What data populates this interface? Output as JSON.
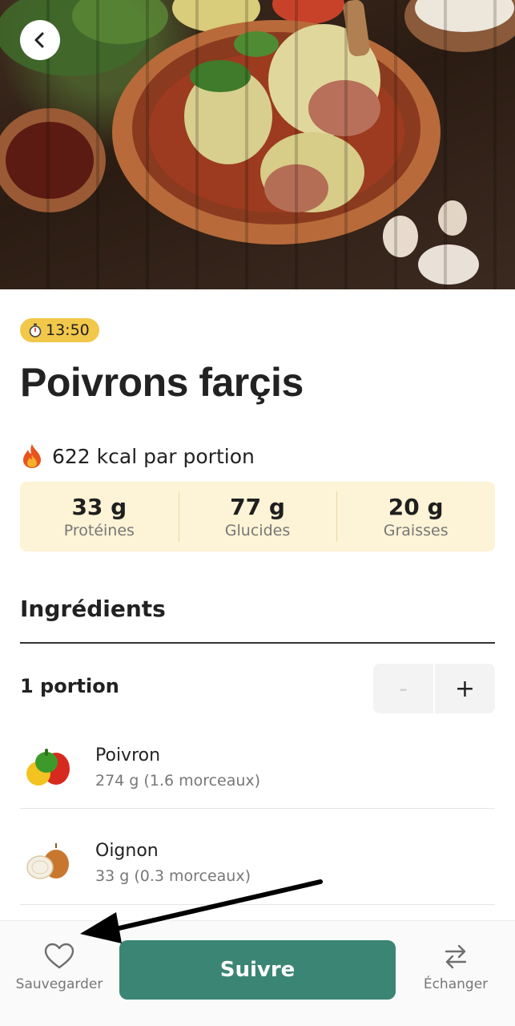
{
  "header": {
    "back_icon": "chevron-left-icon"
  },
  "recipe": {
    "time": "13:50",
    "title": "Poivrons farçis",
    "kcal_text": "622 kcal par portion",
    "macros": [
      {
        "value": "33 g",
        "label": "Protéines"
      },
      {
        "value": "77 g",
        "label": "Glucides"
      },
      {
        "value": "20 g",
        "label": "Graisses"
      }
    ]
  },
  "ingredients": {
    "title": "Ingrédients",
    "portion_label": "1 portion",
    "stepper": {
      "minus": "-",
      "plus": "+"
    },
    "items": [
      {
        "name": "Poivron",
        "qty": "274 g (1.6 morceaux)",
        "icon": "bell-pepper-icon"
      },
      {
        "name": "Oignon",
        "qty": "33 g (0.3 morceaux)",
        "icon": "onion-icon"
      }
    ]
  },
  "bottom_bar": {
    "save_label": "Sauvegarder",
    "follow_label": "Suivre",
    "swap_label": "Échanger"
  },
  "colors": {
    "accent": "#3b8574",
    "timer_badge": "#f2c84b",
    "macro_bg": "#fdf3d6"
  }
}
